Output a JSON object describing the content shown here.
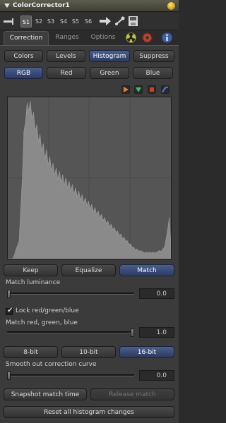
{
  "title": "ColorCorrector1",
  "slots": [
    "S1",
    "S2",
    "S3",
    "S4",
    "S5",
    "S6"
  ],
  "tabs": [
    "Correction",
    "Ranges",
    "Options"
  ],
  "modes": [
    "Colors",
    "Levels",
    "Histogram",
    "Suppress"
  ],
  "selected_mode": "Histogram",
  "channels": [
    "RGB",
    "Red",
    "Green",
    "Blue"
  ],
  "selected_channel": "RGB",
  "actions": [
    "Keep",
    "Equalize",
    "Match"
  ],
  "selected_action": "Match",
  "match_luminance": {
    "label": "Match luminance",
    "value": "0.0",
    "fraction": 0.0
  },
  "lock_rgb": {
    "label": "Lock red/green/blue",
    "checked": true
  },
  "match_rgb": {
    "label": "Match red, green, blue",
    "value": "1.0",
    "fraction": 1.0
  },
  "bitdepths": [
    "8-bit",
    "10-bit",
    "16-bit"
  ],
  "selected_bitdepth": "16-bit",
  "smooth_curve": {
    "label": "Smooth out correction curve",
    "value": "0.0",
    "fraction": 0.0
  },
  "snapshot_label": "Snapshot match time",
  "release_label": "Release match",
  "reset_label": "Reset all histogram changes",
  "histogram": [
    0,
    0,
    0,
    0,
    2,
    6,
    8,
    12,
    30,
    55,
    78,
    92,
    96,
    99,
    97,
    94,
    90,
    86,
    82,
    79,
    76,
    73,
    70,
    68,
    66,
    64,
    62,
    60,
    58,
    57,
    55,
    54,
    53,
    52,
    51,
    50,
    49,
    48,
    47,
    46,
    45,
    44,
    43,
    42,
    41,
    40,
    39,
    38,
    37,
    36,
    35,
    34,
    33,
    32,
    31,
    30,
    29,
    28,
    27,
    26,
    25,
    24,
    23,
    22,
    21,
    20,
    19,
    18,
    17,
    16,
    15,
    14,
    13,
    12,
    11,
    10,
    9,
    8,
    7,
    6,
    6,
    5,
    5,
    5,
    4,
    4,
    4,
    4,
    4,
    4,
    4,
    4,
    4,
    5,
    5,
    5,
    6,
    8,
    12,
    20,
    25,
    10
  ]
}
